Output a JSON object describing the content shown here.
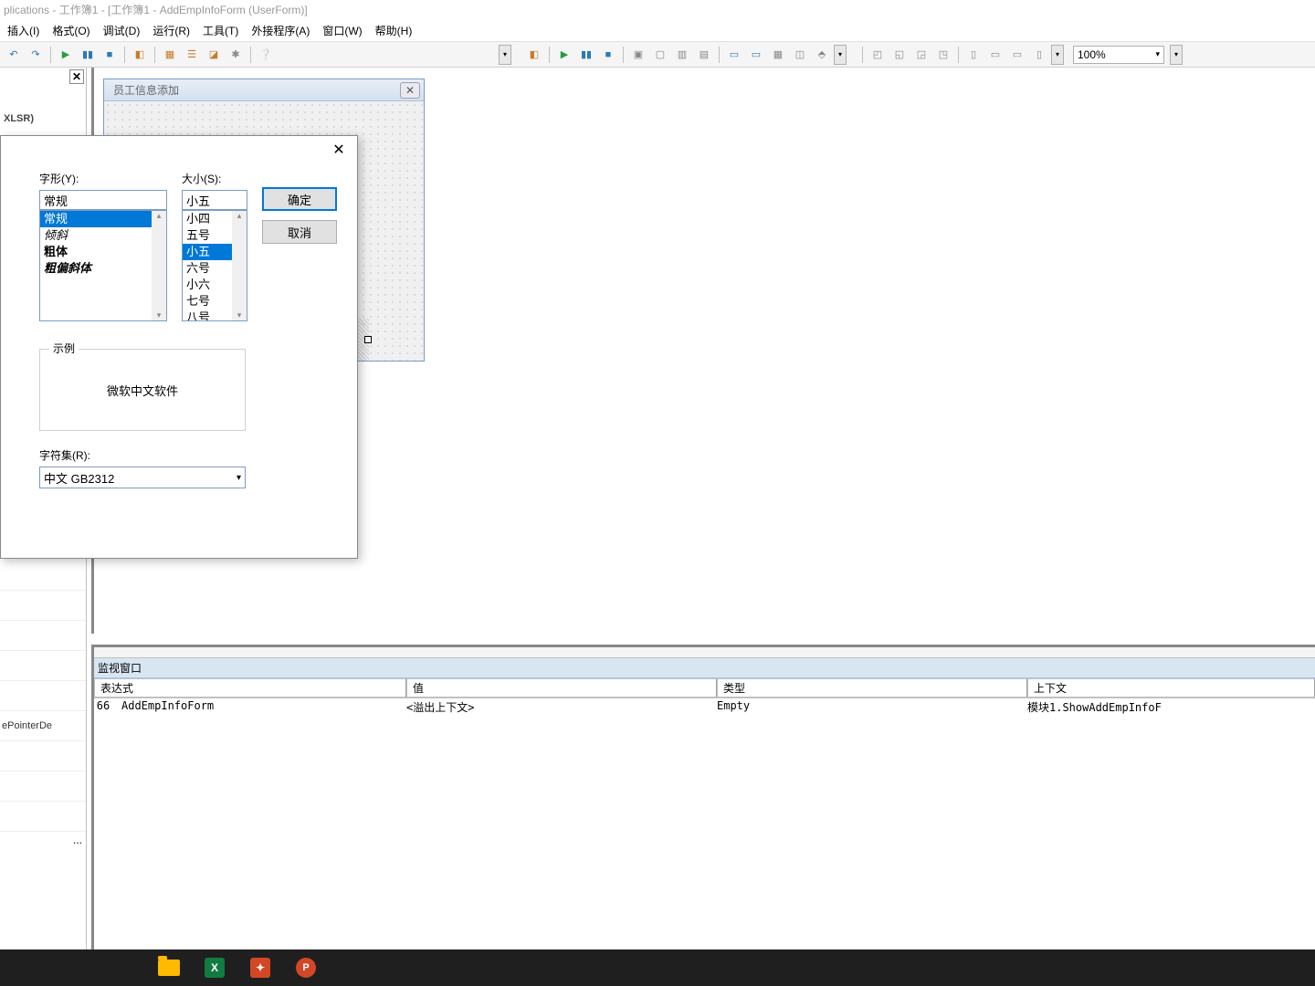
{
  "title": "plications - 工作簿1 - [工作簿1 - AddEmpInfoForm (UserForm)]",
  "menu": {
    "insert": "插入(I)",
    "format": "格式(O)",
    "debug": "调试(D)",
    "run": "运行(R)",
    "tools": "工具(T)",
    "addins": "外接程序(A)",
    "window": "窗口(W)",
    "help": "帮助(H)"
  },
  "toolbar": {
    "zoom": "100%"
  },
  "project": {
    "xlsr": "XLSR)"
  },
  "userform": {
    "title": "员工信息添加"
  },
  "fontDialog": {
    "styleLabel": "字形(Y):",
    "sizeLabel": "大小(S):",
    "styleValue": "常规",
    "sizeValue": "小五",
    "styles": [
      "常规",
      "倾斜",
      "粗体",
      "粗偏斜体"
    ],
    "sizes": [
      "小四",
      "五号",
      "小五",
      "六号",
      "小六",
      "七号",
      "八号"
    ],
    "ok": "确定",
    "cancel": "取消",
    "sampleLabel": "示例",
    "sampleText": "微软中文软件",
    "charsetLabel": "字符集(R):",
    "charsetValue": "中文 GB2312"
  },
  "props": {
    "pointer": "ePointerDe"
  },
  "watches": {
    "title": "监视窗口",
    "cols": {
      "expr": "表达式",
      "value": "值",
      "type": "类型",
      "context": "上下文"
    },
    "row": {
      "icon": "66",
      "expr": "AddEmpInfoForm",
      "value": "<溢出上下文>",
      "type": "Empty",
      "context": "模块1.ShowAddEmpInfoF"
    }
  }
}
